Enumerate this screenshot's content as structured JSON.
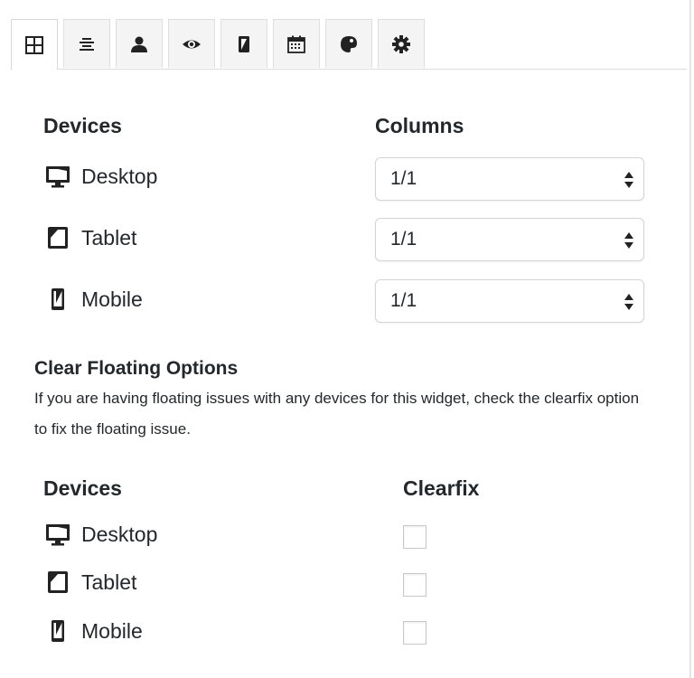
{
  "tabs": [
    {
      "icon": "grid-icon",
      "active": true
    },
    {
      "icon": "align-center-icon"
    },
    {
      "icon": "user-icon"
    },
    {
      "icon": "eye-icon"
    },
    {
      "icon": "mobile-icon"
    },
    {
      "icon": "calendar-icon"
    },
    {
      "icon": "palette-icon"
    },
    {
      "icon": "gear-icon"
    }
  ],
  "columns_section": {
    "devices_heading": "Devices",
    "columns_heading": "Columns",
    "rows": [
      {
        "device": "Desktop",
        "icon": "desktop-icon",
        "value": "1/1"
      },
      {
        "device": "Tablet",
        "icon": "tablet-icon",
        "value": "1/1"
      },
      {
        "device": "Mobile",
        "icon": "mobile-icon",
        "value": "1/1"
      }
    ]
  },
  "clear_floating": {
    "title": "Clear Floating Options",
    "description": "If you are having floating issues with any devices for this widget, check the clearfix option to fix the floating issue."
  },
  "clearfix_section": {
    "devices_heading": "Devices",
    "clearfix_heading": "Clearfix",
    "rows": [
      {
        "device": "Desktop",
        "icon": "desktop-icon",
        "checked": false
      },
      {
        "device": "Tablet",
        "icon": "tablet-icon",
        "checked": false
      },
      {
        "device": "Mobile",
        "icon": "mobile-icon",
        "checked": false
      }
    ]
  }
}
